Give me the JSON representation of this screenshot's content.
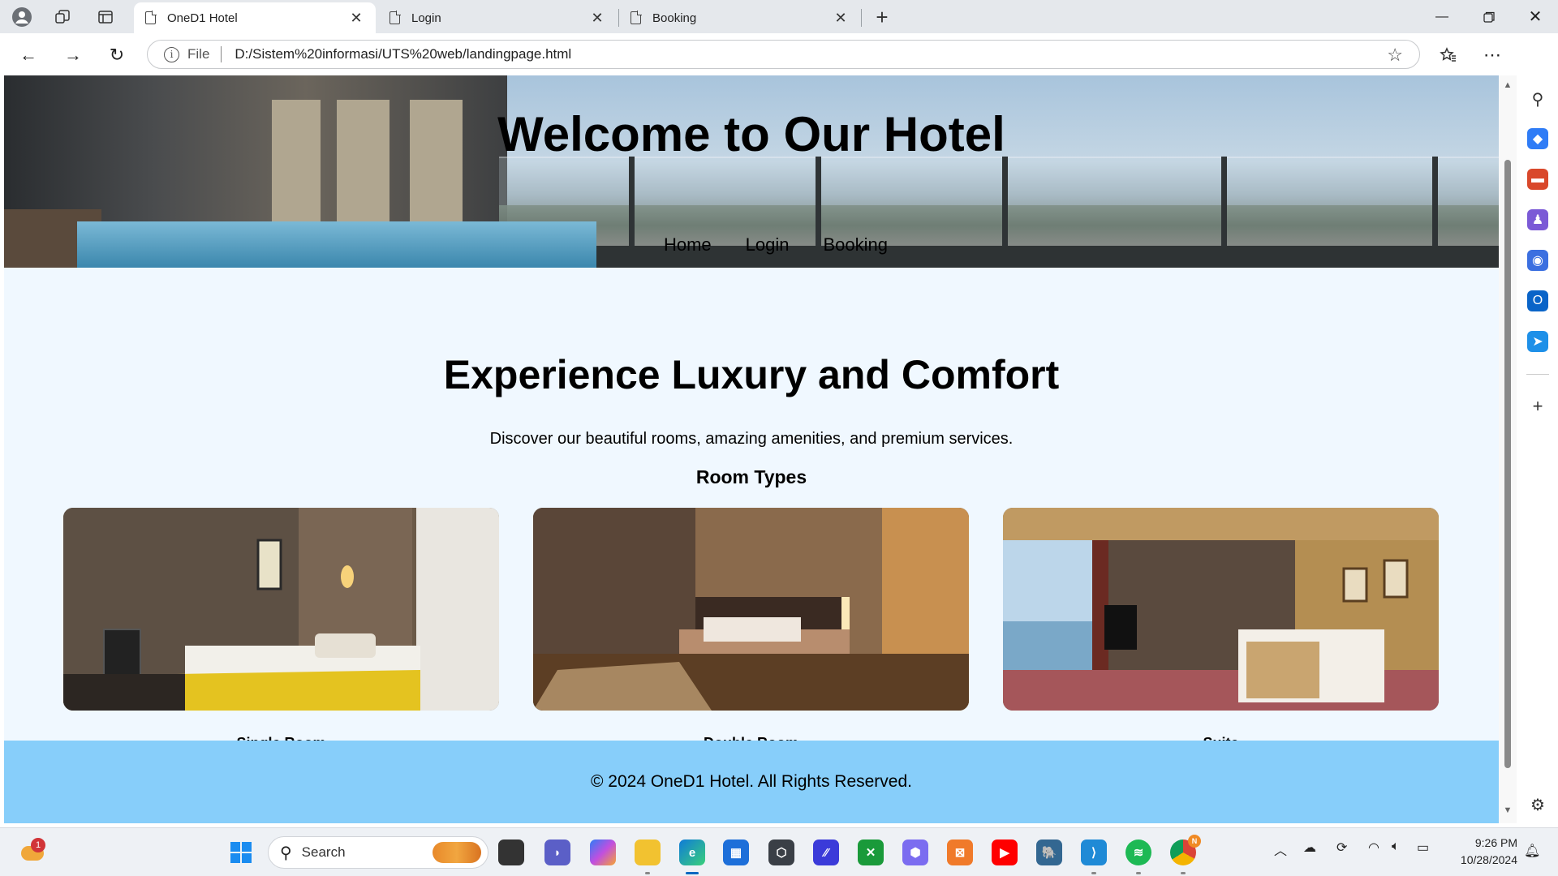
{
  "browser": {
    "tabs": [
      {
        "label": "OneD1 Hotel",
        "active": true
      },
      {
        "label": "Login",
        "active": false
      },
      {
        "label": "Booking",
        "active": false
      }
    ],
    "address": {
      "scheme_label": "File",
      "url": "D:/Sistem%20informasi/UTS%20web/landingpage.html"
    }
  },
  "page": {
    "hero_title": "Welcome to Our Hotel",
    "nav": [
      {
        "label": "Home"
      },
      {
        "label": "Login"
      },
      {
        "label": "Booking"
      }
    ],
    "main_title": "Experience Luxury and Comfort",
    "main_subtitle": "Discover our beautiful rooms, amazing amenities, and premium services.",
    "room_heading": "Room Types",
    "rooms": [
      {
        "name": "Single Room"
      },
      {
        "name": "Double Room"
      },
      {
        "name": "Suite"
      }
    ],
    "footer": "© 2024 OneD1 Hotel. All Rights Reserved."
  },
  "taskbar": {
    "weather_badge": "1",
    "search_placeholder": "Search",
    "clock_time": "9:26 PM",
    "clock_date": "10/28/2024",
    "chrome_badge": "N"
  },
  "colors": {
    "page_background": "#f0f8ff",
    "footer_background": "#87cefa",
    "taskbar_accent": "#0067c0"
  }
}
